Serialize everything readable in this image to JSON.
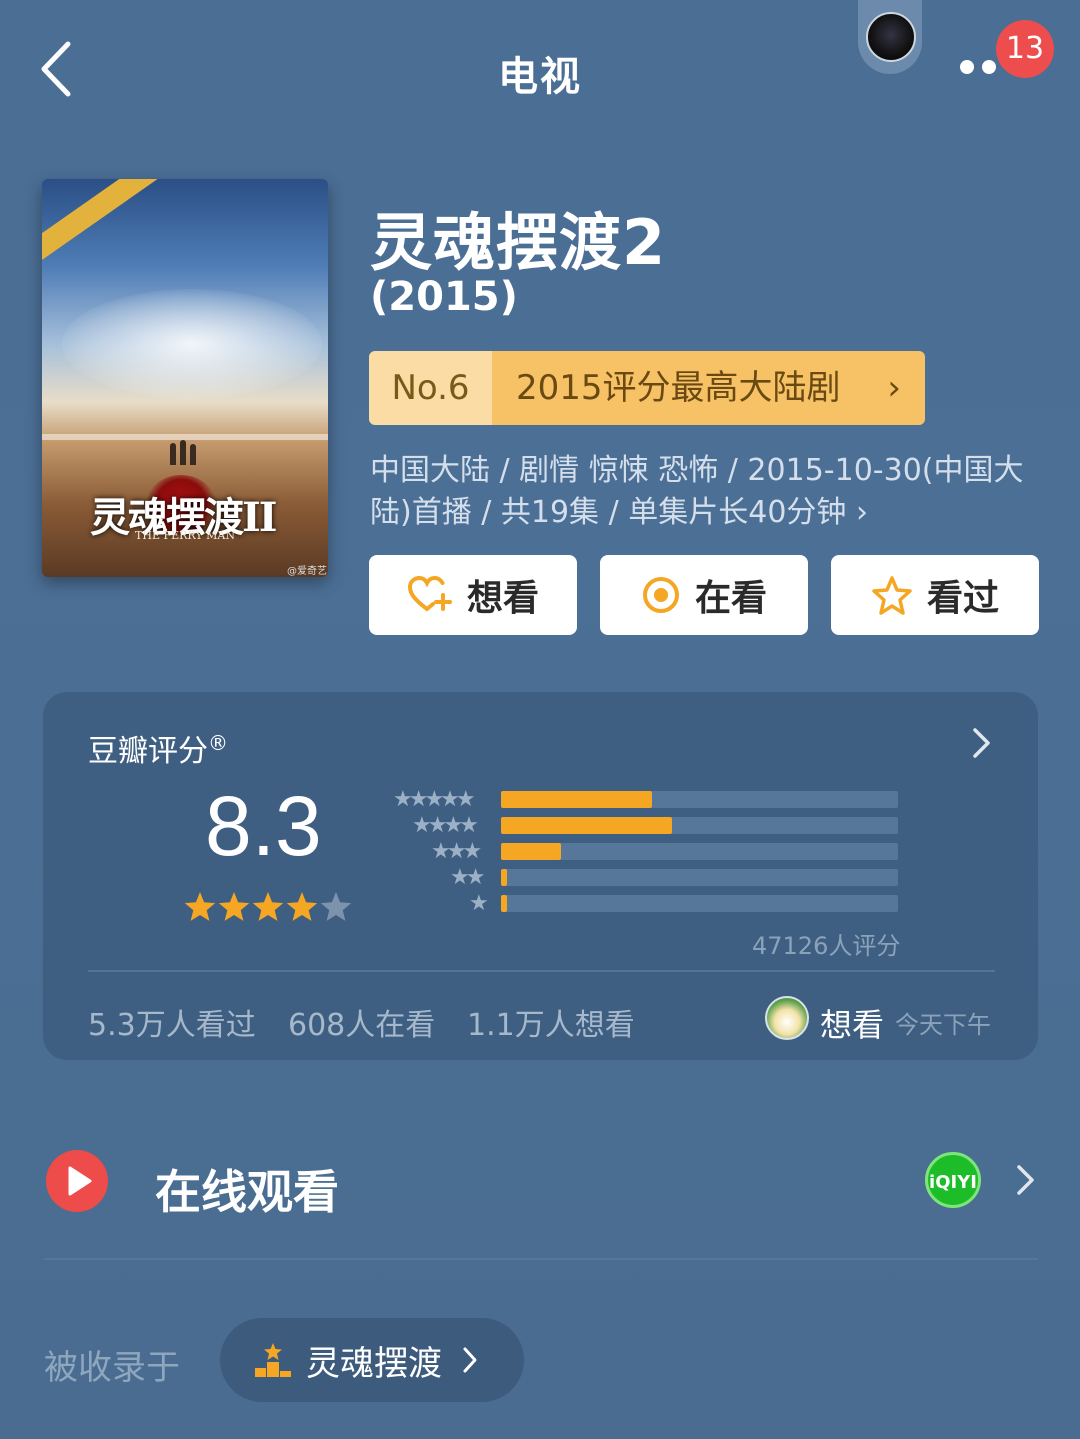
{
  "nav": {
    "title": "电视",
    "avatar_text": "",
    "badge_count": "13"
  },
  "poster": {
    "title_text": "灵魂摆渡II",
    "subtitle_text": "THE FERRY MAN",
    "corner_text": "",
    "watermark": "@爱奇艺"
  },
  "movie": {
    "title": "灵魂摆渡2",
    "year": "(2015)",
    "rank": {
      "no": "No.6",
      "text": "2015评分最高大陆剧",
      "chevron": "›"
    },
    "meta": "中国大陆 / 剧情 惊悚 恐怖 / 2015-10-30(中国大陆)首播 / 共19集 / 单集片长40分钟 ›"
  },
  "actions": [
    {
      "label": "想看",
      "icon": "heart-plus-icon"
    },
    {
      "label": "在看",
      "icon": "target-circle-icon"
    },
    {
      "label": "看过",
      "icon": "star-outline-icon"
    }
  ],
  "rating": {
    "label": "豆瓣评分",
    "registered": "®",
    "score": "8.3",
    "stars_value": 4,
    "stars_max": 5,
    "count_text": "47126人评分",
    "distribution": [
      {
        "stars": 5,
        "glyphs": "★★★★★",
        "fraction": 0.38
      },
      {
        "stars": 4,
        "glyphs": "★★★★",
        "fraction": 0.43
      },
      {
        "stars": 3,
        "glyphs": "★★★",
        "fraction": 0.15
      },
      {
        "stars": 2,
        "glyphs": "★★",
        "fraction": 0.015
      },
      {
        "stars": 1,
        "glyphs": "★",
        "fraction": 0.015
      }
    ],
    "stats": {
      "watched": "5.3万人看过",
      "watching": "608人在看",
      "want": "1.1万人想看"
    },
    "friend": {
      "action": "想看",
      "time": "今天下午"
    }
  },
  "online": {
    "title": "在线观看",
    "provider": "iQIYI"
  },
  "collection": {
    "label": "被收录于",
    "name": "灵魂摆渡",
    "chevron": "›"
  },
  "colors": {
    "background": "#4a6e94",
    "card": "#3f5f82",
    "accent_orange": "#f5a623",
    "rank_light": "#fbdca4",
    "rank_dark": "#f7c265",
    "badge_red": "#ee4d4d",
    "play_red": "#ee4b4b",
    "iqiyi_green": "#1dbd2a"
  }
}
